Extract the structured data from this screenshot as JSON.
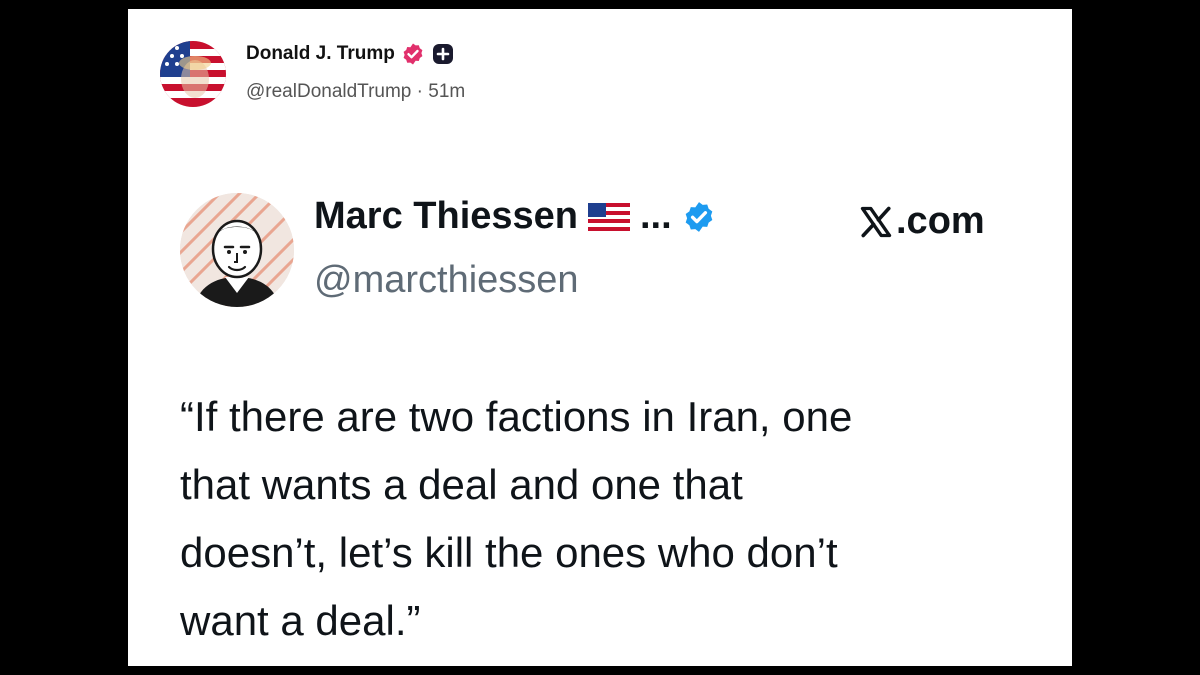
{
  "post": {
    "author_name": "Donald J. Trump",
    "author_handle": "@realDonaldTrump",
    "timestamp": "51m",
    "separator": "·",
    "avatar_icon": "flag-portrait-avatar",
    "verified_icon": "verified-badge-icon",
    "verified_color": "#e1306c",
    "follow_icon": "plus-badge-icon"
  },
  "embedded_tweet": {
    "author_name": "Marc Thiessen",
    "name_suffix": "...",
    "flag_icon": "us-flag-icon",
    "verified_icon": "verified-check-icon",
    "verified_color": "#1d9bf0",
    "author_handle": "@marcthiessen",
    "source_label": ".com",
    "source_icon": "x-logo-icon",
    "text": "“If there are two factions in Iran, one\nthat wants a deal and one that\ndoesn’t, let’s kill the ones who don’t\nwant a deal.”"
  }
}
